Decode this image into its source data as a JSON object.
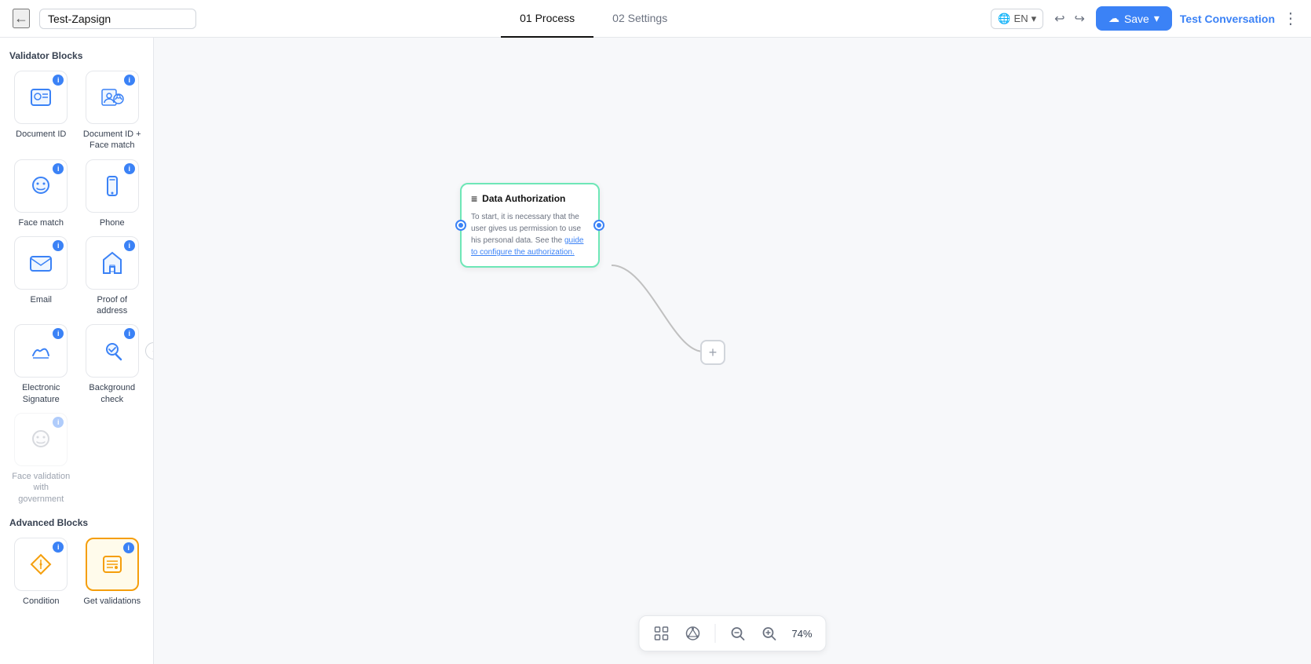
{
  "topbar": {
    "back_icon": "←",
    "title": "Test-Zapsign",
    "tab_process": "01 Process",
    "tab_settings": "02 Settings",
    "lang": "EN",
    "lang_icon": "🌐",
    "undo_icon": "↩",
    "redo_icon": "↪",
    "save_label": "Save",
    "save_icon": "☁",
    "test_conversation": "Test Conversation",
    "more_icon": "⋮"
  },
  "sidebar": {
    "validator_title": "Validator Blocks",
    "advanced_title": "Advanced Blocks",
    "toggle_icon": "‹",
    "blocks": [
      {
        "id": "document-id",
        "label": "Document ID",
        "disabled": false,
        "highlighted": false
      },
      {
        "id": "document-id-face",
        "label": "Document ID + Face match",
        "disabled": false,
        "highlighted": false
      },
      {
        "id": "face-match",
        "label": "Face match",
        "disabled": false,
        "highlighted": false
      },
      {
        "id": "phone",
        "label": "Phone",
        "disabled": false,
        "highlighted": false
      },
      {
        "id": "email",
        "label": "Email",
        "disabled": false,
        "highlighted": false
      },
      {
        "id": "proof-of-address",
        "label": "Proof of address",
        "disabled": false,
        "highlighted": false
      },
      {
        "id": "electronic-signature",
        "label": "Electronic Signature",
        "disabled": false,
        "highlighted": false
      },
      {
        "id": "background-check",
        "label": "Background check",
        "disabled": false,
        "highlighted": false
      },
      {
        "id": "face-validation-gov",
        "label": "Face validation with government",
        "disabled": true,
        "highlighted": false
      }
    ],
    "advanced_blocks": [
      {
        "id": "condition",
        "label": "Condition",
        "disabled": false,
        "highlighted": false
      },
      {
        "id": "get-validations",
        "label": "Get validations",
        "disabled": false,
        "highlighted": true
      }
    ]
  },
  "canvas": {
    "node": {
      "title": "Data Authorization",
      "body_text": "To start, it is necessary that the user gives us permission to use his personal data. See the",
      "link_text": "guide to configure the authorization.",
      "link_href": "#"
    },
    "zoom_percent": "74%"
  },
  "bottombar": {
    "focus_icon": "⊙",
    "share_icon": "⬡",
    "zoom_in_icon": "+",
    "zoom_out_icon": "−",
    "zoom": "74%"
  }
}
